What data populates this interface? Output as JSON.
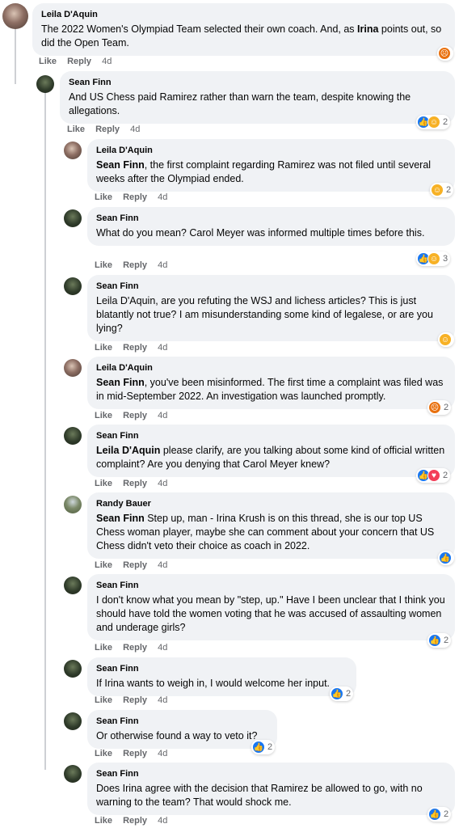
{
  "comments": [
    {
      "author": "Leila D'Aquin",
      "pre": "The 2022 Women's Olympiad Team selected their own coach. And, as ",
      "bold": "Irina",
      "post": " points out, so did the Open Team.",
      "like": "Like",
      "reply": "Reply",
      "time": "4d",
      "reaction_count": ""
    },
    {
      "author": "Sean Finn",
      "pre": "",
      "bold": "",
      "post": "And US Chess paid Ramirez rather than warn the team, despite knowing the allegations.",
      "like": "Like",
      "reply": "Reply",
      "time": "4d",
      "reaction_count": "2"
    },
    {
      "author": "Leila D'Aquin",
      "pre": "",
      "bold": "Sean Finn",
      "post": ", the first complaint regarding Ramirez was not filed until several weeks after the Olympiad ended.",
      "like": "Like",
      "reply": "Reply",
      "time": "4d",
      "reaction_count": "2"
    },
    {
      "author": "Sean Finn",
      "pre": "",
      "bold": "",
      "post": "What do you mean? Carol Meyer was informed multiple times before this.",
      "like": "Like",
      "reply": "Reply",
      "time": "4d",
      "reaction_count": "3"
    },
    {
      "author": "Sean Finn",
      "pre": "",
      "bold": "",
      "post": "Leila D'Aquin, are you refuting the WSJ and lichess articles? This is just blatantly not true? I am misunderstanding some kind of legalese, or are you lying?",
      "like": "Like",
      "reply": "Reply",
      "time": "4d",
      "reaction_count": ""
    },
    {
      "author": "Leila D'Aquin",
      "pre": "",
      "bold": "Sean Finn",
      "post": ", you've been misinformed. The first time a complaint was filed was in mid-September 2022. An investigation was launched promptly.",
      "like": "Like",
      "reply": "Reply",
      "time": "4d",
      "reaction_count": "2"
    },
    {
      "author": "Sean Finn",
      "pre": "",
      "bold": "Leila D'Aquin",
      "post": " please clarify, are you talking about some kind of official written complaint? Are you denying that Carol Meyer knew?",
      "like": "Like",
      "reply": "Reply",
      "time": "4d",
      "reaction_count": "2"
    },
    {
      "author": "Randy Bauer",
      "pre": "",
      "bold": "Sean Finn",
      "post": " Step up, man - Irina Krush is on this thread, she is our top US Chess woman player, maybe she can comment about your concern that US Chess didn't veto their choice as coach in 2022.",
      "like": "Like",
      "reply": "Reply",
      "time": "4d",
      "reaction_count": ""
    },
    {
      "author": "Sean Finn",
      "pre": "",
      "bold": "",
      "post": "I don't know what you mean by \"step, up.\" Have I been unclear that I think you should have told the women voting that he was accused of assaulting women and underage girls?",
      "like": "Like",
      "reply": "Reply",
      "time": "4d",
      "reaction_count": "2"
    },
    {
      "author": "Sean Finn",
      "pre": "",
      "bold": "",
      "post": "If Irina wants to weigh in, I would welcome her input.",
      "like": "Like",
      "reply": "Reply",
      "time": "4d",
      "reaction_count": "2"
    },
    {
      "author": "Sean Finn",
      "pre": "",
      "bold": "",
      "post": "Or otherwise found a way to veto it?",
      "like": "Like",
      "reply": "Reply",
      "time": "4d",
      "reaction_count": "2"
    },
    {
      "author": "Sean Finn",
      "pre": "",
      "bold": "",
      "post": "Does Irina agree with the decision that Ramirez be allowed to go, with no warning to the team? That would shock me.",
      "like": "Like",
      "reply": "Reply",
      "time": "4d",
      "reaction_count": "2"
    }
  ],
  "reaction_icons": {
    "c0": [
      "angry-icon"
    ],
    "c1": [
      "like-icon",
      "care-icon"
    ],
    "c2": [
      "haha-icon"
    ],
    "c3": [
      "like-icon",
      "care-icon"
    ],
    "c4": [
      "care-icon"
    ],
    "c5": [
      "angry-icon"
    ],
    "c6": [
      "like-icon",
      "love-icon"
    ],
    "c7": [
      "like-icon"
    ],
    "c8": [
      "like-icon"
    ],
    "c9": [
      "like-icon"
    ],
    "c10": [
      "like-icon"
    ],
    "c11": [
      "like-icon"
    ]
  },
  "colors": {
    "bubble": "#f0f2f5",
    "meta": "#65676b",
    "like_blue": "#1877f2",
    "thread_line": "#ced0d4"
  }
}
